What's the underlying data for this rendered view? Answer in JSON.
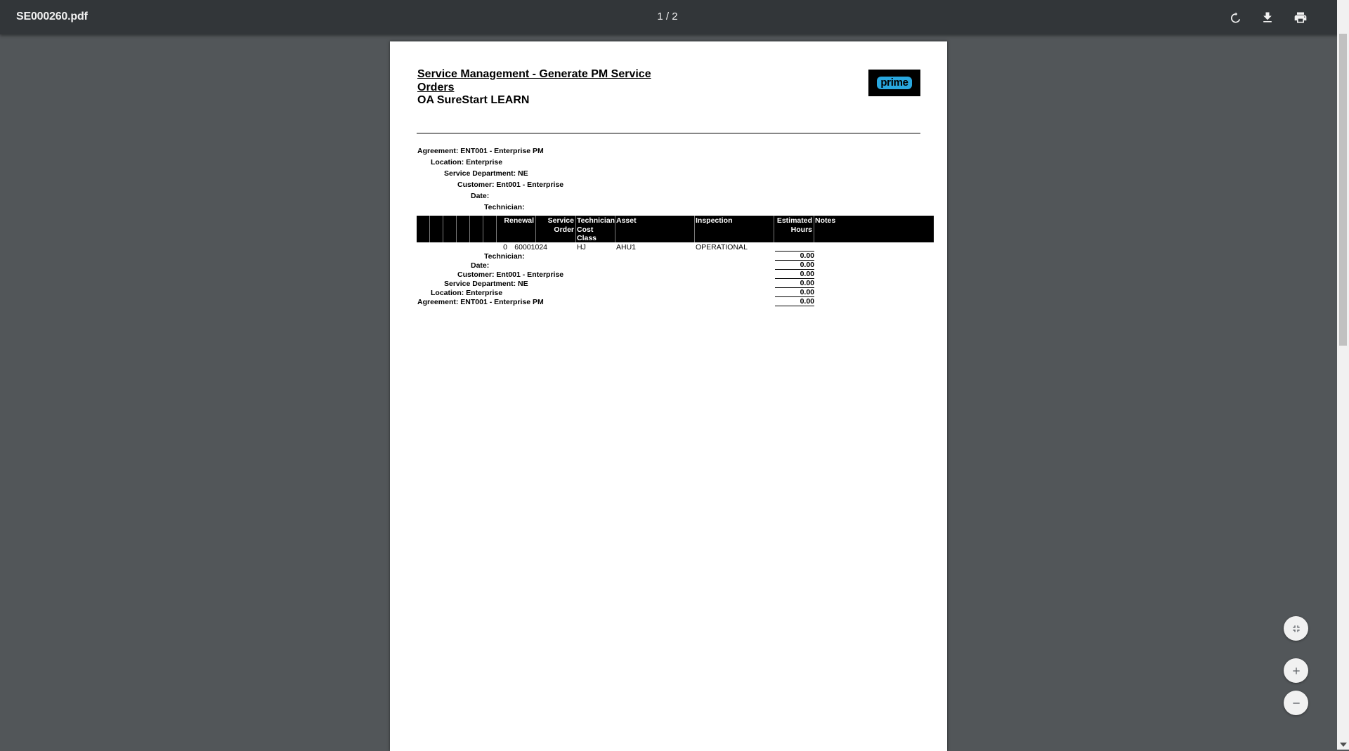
{
  "toolbar": {
    "file_name": "SE000260.pdf",
    "page_indicator": "1 / 2",
    "icons": [
      "rotate-icon",
      "download-icon",
      "print-icon"
    ]
  },
  "report": {
    "title": "Service Management - Generate PM Service Orders",
    "company": "OA SureStart LEARN",
    "logo_text": "prime",
    "header_groups": {
      "agreement": "Agreement: ENT001 - Enterprise PM",
      "location": "Location: Enterprise",
      "service_department": "Service Department: NE",
      "customer": "Customer: Ent001 - Enterprise",
      "date": "Date:",
      "technician": "Technician:"
    },
    "columns": {
      "renewal": "Renewal",
      "service_order_1": "Service",
      "service_order_2": "Order",
      "tech_cost_1": "Technician",
      "tech_cost_2": "Cost",
      "tech_cost_3": "Class",
      "asset": "Asset",
      "inspection": "Inspection",
      "est_hours_1": "Estimated",
      "est_hours_2": "Hours",
      "notes": "Notes"
    },
    "rows": [
      {
        "renewal": "0",
        "service_order": "60001024",
        "tech_cost_class": "HJ",
        "asset": "AHU1",
        "inspection": "OPERATIONAL"
      }
    ],
    "footer_groups": {
      "technician": "Technician:",
      "date": "Date:",
      "customer": "Customer: Ent001 - Enterprise",
      "service_department": "Service Department: NE",
      "location": "Location: Enterprise",
      "agreement": "Agreement: ENT001 - Enterprise PM"
    },
    "totals": [
      "0.00",
      "0.00",
      "0.00",
      "0.00",
      "0.00",
      "0.00"
    ]
  },
  "controls": {
    "icons": [
      "fit-to-page-icon",
      "zoom-in-icon",
      "zoom-out-icon"
    ]
  }
}
